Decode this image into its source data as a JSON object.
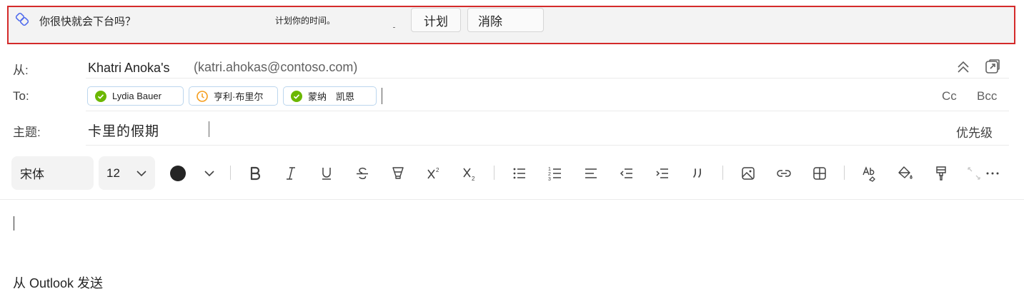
{
  "banner": {
    "question": "你很快就会下台吗？",
    "hint": "计划你的时间。",
    "plan_label": "计划",
    "dismiss_label": "消除"
  },
  "from": {
    "label": "从:",
    "name": "Khatri Anoka's",
    "email": "(katri.ahokas@contoso.com)"
  },
  "to": {
    "label": "To:",
    "recipients": [
      {
        "name": "Lydia Bauer",
        "status": "available"
      },
      {
        "name": "亨利·布里尔",
        "status": "away"
      },
      {
        "name": "蒙纳　凯恩",
        "status": "available"
      }
    ],
    "cc_label": "Cc",
    "bcc_label": "Bcc"
  },
  "subject": {
    "label": "主题:",
    "value": "卡里的假期",
    "priority_label": "优先级"
  },
  "toolbar": {
    "font": "宋体",
    "font_size": "12",
    "text_color": "#242424",
    "buttons": [
      "bold",
      "italic",
      "underline",
      "strikethrough",
      "highlight",
      "superscript",
      "subscript",
      "bullets",
      "numbering",
      "align-left",
      "decrease-indent",
      "increase-indent",
      "quote",
      "insert-picture",
      "insert-link",
      "insert-table",
      "spelling",
      "fill-color",
      "format-painter",
      "more"
    ]
  },
  "body": {
    "signature": "从 Outlook 发送"
  },
  "colors": {
    "banner_border": "#d42a2a",
    "presence_available": "#6bb700",
    "presence_away": "#f59d1c",
    "chip_border": "#bcd6ee"
  }
}
